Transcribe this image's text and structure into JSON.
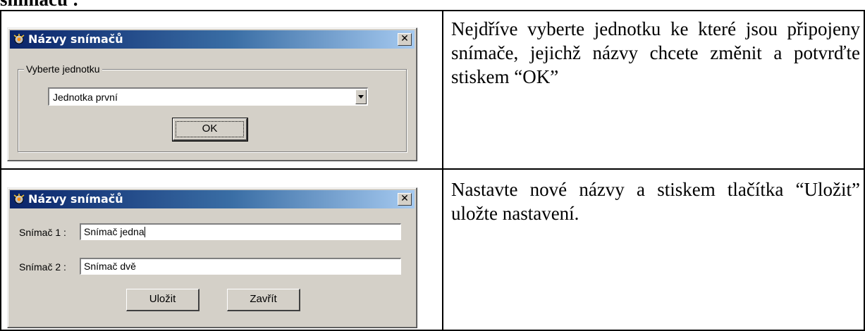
{
  "document": {
    "heading_fragment": "snímačů :"
  },
  "rows": [
    {
      "description": "Nejdříve vyberte jednotku ke které jsou připojeny snímače, jejichž  názvy chcete změnit a potvrďte stiskem “OK”",
      "dialog": {
        "title": "Názvy snímačů",
        "close_label": "✕",
        "group_label": "Vyberte jednotku",
        "unit_select_value": "Jednotka první",
        "ok_label": "OK"
      }
    },
    {
      "description": "Nastavte nové názvy a stiskem tlačítka “Uložit” uložte nastavení.",
      "dialog": {
        "title": "Názvy snímačů",
        "close_label": "✕",
        "sensor1_label": "Snímač 1 :",
        "sensor1_value": "Snímač jedna",
        "sensor2_label": "Snímač 2 :",
        "sensor2_value": "Snímač dvě",
        "save_label": "Uložit",
        "close_button_label": "Zavřít"
      }
    }
  ],
  "colors": {
    "titlebar_start": "#0a246a",
    "titlebar_end": "#a6caf0",
    "dialog_face": "#d4d0c8"
  },
  "icons": [
    "app-icon",
    "close-icon",
    "dropdown-arrow-icon"
  ]
}
